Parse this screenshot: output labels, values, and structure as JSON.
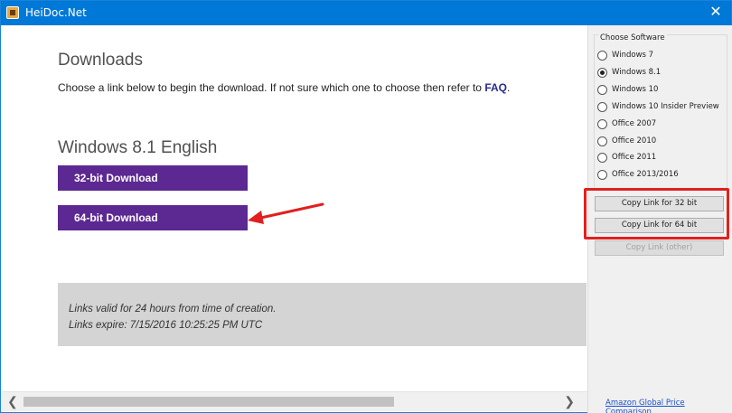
{
  "window": {
    "title": "HeiDoc.Net",
    "close_glyph": "✕"
  },
  "main": {
    "heading": "Downloads",
    "intro_text": "Choose a link below to begin the download. If not sure which one to choose then refer to ",
    "intro_link": "FAQ",
    "intro_end": ".",
    "version_heading": "Windows 8.1 English",
    "download_32": "32-bit Download",
    "download_64": "64-bit Download",
    "info_line1": "Links valid for 24 hours from time of creation.",
    "info_line2": "Links expire: 7/15/2016 10:25:25 PM UTC"
  },
  "sidebar": {
    "group_label": "Choose Software",
    "options": [
      {
        "label": "Windows 7",
        "checked": false
      },
      {
        "label": "Windows 8.1",
        "checked": true
      },
      {
        "label": "Windows 10",
        "checked": false
      },
      {
        "label": "Windows 10 Insider Preview",
        "checked": false
      },
      {
        "label": "Office 2007",
        "checked": false
      },
      {
        "label": "Office 2010",
        "checked": false
      },
      {
        "label": "Office 2011",
        "checked": false
      },
      {
        "label": "Office 2013/2016",
        "checked": false
      }
    ],
    "copy_32": "Copy Link for 32 bit",
    "copy_64": "Copy Link for 64 bit",
    "copy_other": "Copy Link (other)",
    "amazon_link": "Amazon Global Price Comparison"
  },
  "scrollbar": {
    "left_glyph": "❮",
    "right_glyph": "❯"
  },
  "colors": {
    "titlebar": "#0078d7",
    "download_button": "#5c2891",
    "highlight": "#e02020",
    "link": "#2b2b8f"
  },
  "icons": [
    "app-icon",
    "close-icon",
    "arrow-annotation-icon",
    "scroll-left-icon",
    "scroll-right-icon"
  ]
}
